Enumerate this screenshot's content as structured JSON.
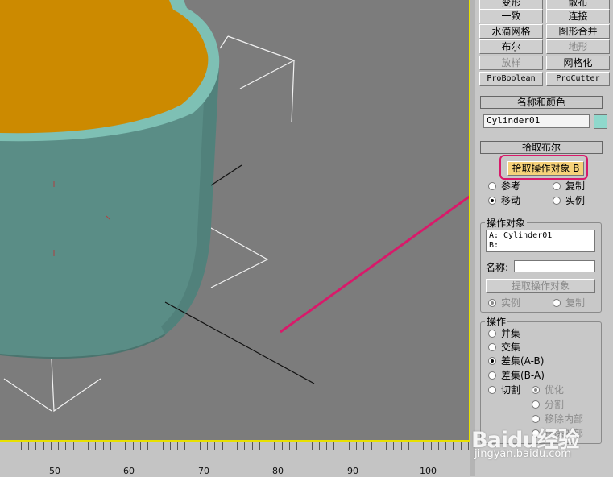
{
  "compound_buttons": [
    {
      "label": "变形",
      "disabled": false
    },
    {
      "label": "散布",
      "disabled": false
    },
    {
      "label": "一致",
      "disabled": false
    },
    {
      "label": "连接",
      "disabled": false
    },
    {
      "label": "水滴网格",
      "disabled": false
    },
    {
      "label": "图形合并",
      "disabled": false
    },
    {
      "label": "布尔",
      "disabled": false
    },
    {
      "label": "地形",
      "disabled": true
    },
    {
      "label": "放样",
      "disabled": true
    },
    {
      "label": "网格化",
      "disabled": false
    },
    {
      "label": "ProBoolean",
      "disabled": false
    },
    {
      "label": "ProCutter",
      "disabled": false
    }
  ],
  "name_color": {
    "title": "名称和颜色",
    "object_name": "Cylinder01",
    "swatch_color": "#8fd8cc"
  },
  "pick_boolean": {
    "title": "拾取布尔",
    "pick_button": "拾取操作对象 B",
    "options": [
      {
        "label": "参考",
        "checked": false
      },
      {
        "label": "复制",
        "checked": false
      },
      {
        "label": "移动",
        "checked": true
      },
      {
        "label": "实例",
        "checked": false
      }
    ]
  },
  "operands": {
    "group_label": "操作对象",
    "line_a": "A: Cylinder01",
    "line_b": "B:",
    "name_label": "名称:",
    "name_value": "",
    "extract_button": "提取操作对象",
    "extract_options": [
      {
        "label": "实例",
        "checked": true
      },
      {
        "label": "复制",
        "checked": false
      }
    ]
  },
  "operation": {
    "group_label": "操作",
    "options": [
      {
        "label": "并集",
        "checked": false
      },
      {
        "label": "交集",
        "checked": false
      },
      {
        "label": "差集(A-B)",
        "checked": true
      },
      {
        "label": "差集(B-A)",
        "checked": false
      },
      {
        "label": "切割",
        "checked": false
      }
    ],
    "cut_options": [
      {
        "label": "优化",
        "checked": true
      },
      {
        "label": "分割",
        "checked": false
      },
      {
        "label": "移除内部",
        "checked": false
      },
      {
        "label": "移除外部",
        "checked": false
      }
    ]
  },
  "ruler": {
    "labels": [
      "50",
      "60",
      "70",
      "80",
      "90",
      "100"
    ]
  },
  "viewport": {
    "background": "#7c7c7c",
    "cylinder_side": "#5a8d86",
    "cylinder_rim": "#7ec0b4",
    "cylinder_cap": "#cc8a00",
    "highlight_border": "#d81a6a",
    "arrow_color": "#d81a6a"
  },
  "watermark": {
    "logo": "Baidu经验",
    "url": "jingyan.baidu.com"
  }
}
